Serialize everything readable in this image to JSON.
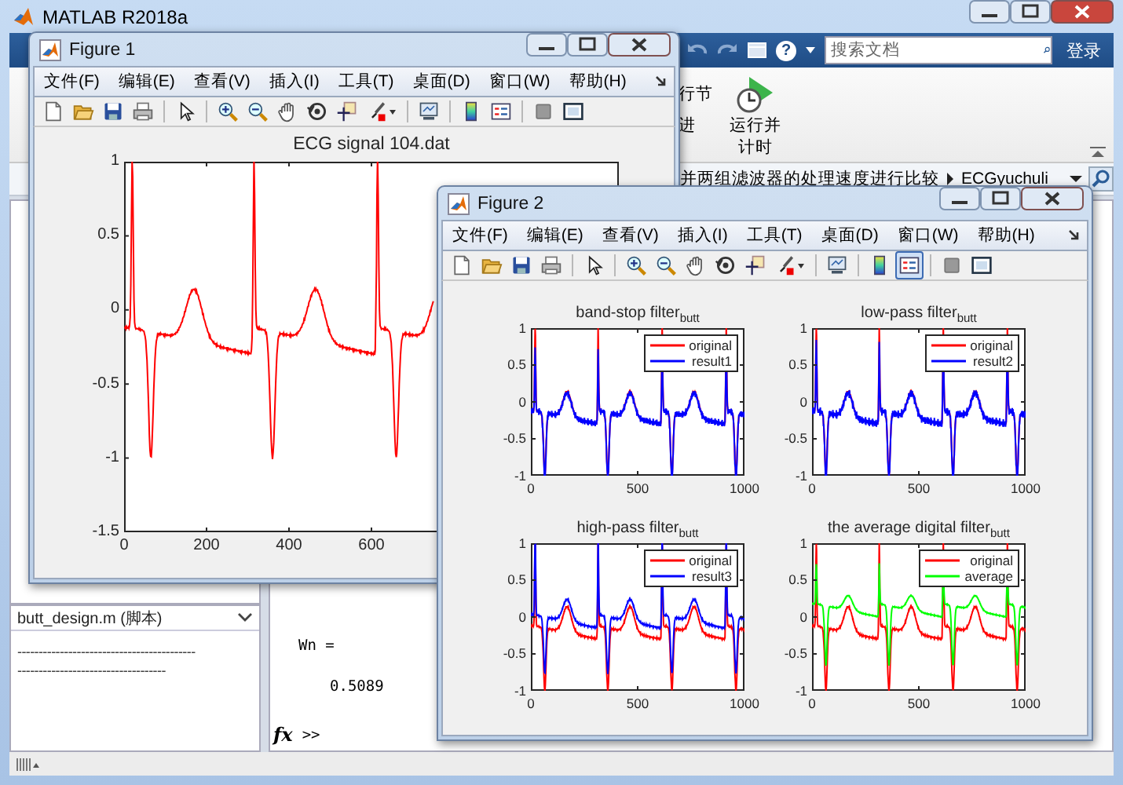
{
  "main": {
    "title": "MATLAB R2018a",
    "help": "?",
    "search": {
      "placeholder": "搜索文档"
    },
    "login": "登录",
    "ribbon": {
      "cut_labels": [
        "行节",
        "进"
      ],
      "run_time": "运行并计时"
    },
    "address": {
      "path": "并两组滤波器的处理速度进行比较",
      "folder": "ECGyuchuli"
    },
    "file_panel": {
      "title": "butt_design.m (脚本)",
      "lines": [
        "------------------------------------------",
        "-----------------------------------"
      ]
    },
    "command_window": {
      "lines": [
        "Wn =",
        "0.5089"
      ],
      "fx": "fx",
      "prompt": ">>"
    }
  },
  "figures": [
    {
      "title": "Figure 1",
      "menu": [
        "文件(F)",
        "编辑(E)",
        "查看(V)",
        "插入(I)",
        "工具(T)",
        "桌面(D)",
        "窗口(W)",
        "帮助(H)"
      ],
      "toolbar": [
        {
          "kind": "new",
          "pressed": false
        },
        {
          "kind": "open",
          "pressed": false
        },
        {
          "kind": "save",
          "pressed": false
        },
        {
          "kind": "print",
          "pressed": false
        },
        {
          "kind": "pointer",
          "pressed": false
        },
        {
          "kind": "zoomin",
          "pressed": false
        },
        {
          "kind": "zoomout",
          "pressed": false
        },
        {
          "kind": "pan",
          "pressed": false
        },
        {
          "kind": "rotate",
          "pressed": false
        },
        {
          "kind": "datacursor",
          "pressed": false
        },
        {
          "kind": "brush",
          "pressed": false
        },
        {
          "kind": "link",
          "pressed": false
        },
        {
          "kind": "colorbar",
          "pressed": false
        },
        {
          "kind": "legend",
          "pressed": false
        },
        {
          "kind": "hidetools",
          "pressed": false
        },
        {
          "kind": "showtools",
          "pressed": false
        }
      ],
      "axes": [
        {
          "kind": "single",
          "title": "ECG signal 104.dat",
          "xticks": [
            "0",
            "200",
            "400",
            "600"
          ],
          "yticks": [
            "1",
            "0.5",
            "0",
            "-0.5",
            "-1",
            "-1.5"
          ],
          "traces": [
            {
              "kind": "original",
              "color": "#ff0000"
            }
          ]
        }
      ]
    },
    {
      "title": "Figure 2",
      "menu": [
        "文件(F)",
        "编辑(E)",
        "查看(V)",
        "插入(I)",
        "工具(T)",
        "桌面(D)",
        "窗口(W)",
        "帮助(H)"
      ],
      "toolbar": [
        {
          "kind": "new",
          "pressed": false
        },
        {
          "kind": "open",
          "pressed": false
        },
        {
          "kind": "save",
          "pressed": false
        },
        {
          "kind": "print",
          "pressed": false
        },
        {
          "kind": "pointer",
          "pressed": false
        },
        {
          "kind": "zoomin",
          "pressed": false
        },
        {
          "kind": "zoomout",
          "pressed": false
        },
        {
          "kind": "pan",
          "pressed": false
        },
        {
          "kind": "rotate",
          "pressed": false
        },
        {
          "kind": "datacursor",
          "pressed": false
        },
        {
          "kind": "brush",
          "pressed": false
        },
        {
          "kind": "link",
          "pressed": false
        },
        {
          "kind": "colorbar",
          "pressed": false
        },
        {
          "kind": "legend",
          "pressed": true
        },
        {
          "kind": "hidetools",
          "pressed": false
        },
        {
          "kind": "showtools",
          "pressed": false
        }
      ],
      "axes": [
        {
          "kind": "subplot",
          "title": "band-stop filter$_{butt}$",
          "xticks": [
            "0",
            "500",
            "1000"
          ],
          "yticks": [
            "1",
            "0.5",
            "0",
            "-0.5",
            "-1"
          ],
          "traces": [
            {
              "kind": "original",
              "label": "original",
              "color": "#ff0000"
            },
            {
              "kind": "bandstop",
              "label": "result1",
              "color": "#0000ff"
            }
          ]
        },
        {
          "kind": "subplot",
          "title": "low-pass filter$_{butt}$",
          "xticks": [
            "0",
            "500",
            "1000"
          ],
          "yticks": [
            "1",
            "0.5",
            "0",
            "-0.5",
            "-1"
          ],
          "traces": [
            {
              "kind": "original",
              "label": "original",
              "color": "#ff0000"
            },
            {
              "kind": "lowpass",
              "label": "result2",
              "color": "#0000ff"
            }
          ]
        },
        {
          "kind": "subplot",
          "title": "high-pass filter$_{butt}$",
          "xticks": [
            "0",
            "500",
            "1000"
          ],
          "yticks": [
            "1",
            "0.5",
            "0",
            "-0.5",
            "-1"
          ],
          "traces": [
            {
              "kind": "original",
              "label": "original",
              "color": "#ff0000"
            },
            {
              "kind": "highpass",
              "label": "result3",
              "color": "#0000ff"
            }
          ]
        },
        {
          "kind": "subplot",
          "title": "the average digital filter$_{butt}$",
          "xticks": [
            "0",
            "500",
            "1000"
          ],
          "yticks": [
            "1",
            "0.5",
            "0",
            "-0.5",
            "-1"
          ],
          "traces": [
            {
              "kind": "original",
              "label": "original",
              "color": "#ff0000"
            },
            {
              "kind": "average",
              "label": "average",
              "color": "#00ff00"
            }
          ]
        }
      ]
    }
  ]
}
